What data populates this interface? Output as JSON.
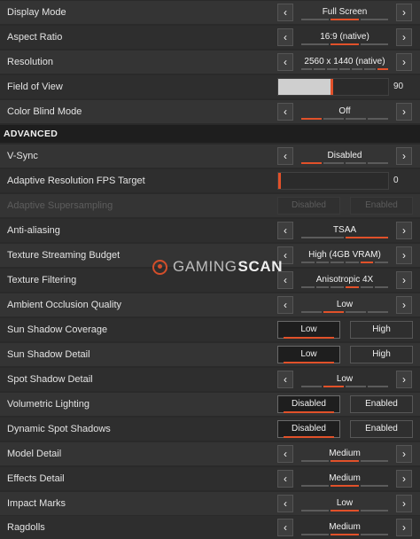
{
  "colors": {
    "accent": "#e1512a",
    "row_bg": "#343434",
    "section_bg": "#1e1e1e"
  },
  "watermark": {
    "brand_a": "GAMING",
    "brand_b": "SCAN"
  },
  "sections": {
    "advanced": "ADVANCED"
  },
  "settings": {
    "display_mode": {
      "label": "Display Mode",
      "value": "Full Screen"
    },
    "aspect_ratio": {
      "label": "Aspect Ratio",
      "value": "16:9 (native)"
    },
    "resolution": {
      "label": "Resolution",
      "value": "2560 x 1440 (native)"
    },
    "field_of_view": {
      "label": "Field of View",
      "value": "90",
      "level": 0.5
    },
    "color_blind_mode": {
      "label": "Color Blind Mode",
      "value": "Off"
    },
    "vsync": {
      "label": "V-Sync",
      "value": "Disabled"
    },
    "adaptive_res_fps": {
      "label": "Adaptive Resolution FPS Target",
      "value": "0",
      "level": 0
    },
    "adaptive_supersampling": {
      "label": "Adaptive Supersampling",
      "opt_a": "Disabled",
      "opt_b": "Enabled"
    },
    "anti_aliasing": {
      "label": "Anti-aliasing",
      "value": "TSAA"
    },
    "texture_streaming_budget": {
      "label": "Texture Streaming Budget",
      "value": "High (4GB VRAM)"
    },
    "texture_filtering": {
      "label": "Texture Filtering",
      "value": "Anisotropic 4X"
    },
    "ambient_occlusion": {
      "label": "Ambient Occlusion Quality",
      "value": "Low"
    },
    "sun_shadow_coverage": {
      "label": "Sun Shadow Coverage",
      "opt_a": "Low",
      "opt_b": "High"
    },
    "sun_shadow_detail": {
      "label": "Sun Shadow Detail",
      "opt_a": "Low",
      "opt_b": "High"
    },
    "spot_shadow_detail": {
      "label": "Spot Shadow Detail",
      "value": "Low"
    },
    "volumetric_lighting": {
      "label": "Volumetric Lighting",
      "opt_a": "Disabled",
      "opt_b": "Enabled"
    },
    "dynamic_spot_shadows": {
      "label": "Dynamic Spot Shadows",
      "opt_a": "Disabled",
      "opt_b": "Enabled"
    },
    "model_detail": {
      "label": "Model Detail",
      "value": "Medium"
    },
    "effects_detail": {
      "label": "Effects Detail",
      "value": "Medium"
    },
    "impact_marks": {
      "label": "Impact Marks",
      "value": "Low"
    },
    "ragdolls": {
      "label": "Ragdolls",
      "value": "Medium"
    }
  },
  "arrows": {
    "left": "‹",
    "right": "›"
  }
}
